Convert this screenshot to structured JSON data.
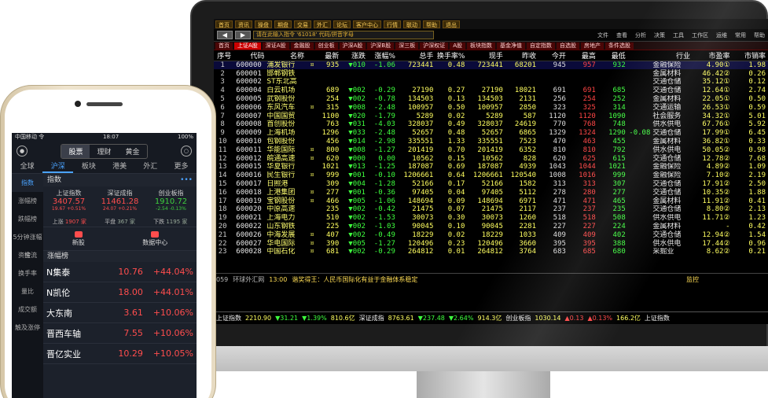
{
  "desktop": {
    "top_menu": [
      "首页",
      "资讯",
      "操盘",
      "期盘",
      "交易",
      "外汇",
      "论坛",
      "客户中心",
      "行情",
      "联动",
      "帮助",
      "退出"
    ],
    "command_placeholder": "请在此输入指令 '61018' 代码/拼音字母",
    "menus": [
      "文件",
      "查看",
      "分析",
      "决策",
      "工具",
      "工作区",
      "运维",
      "常用",
      "帮助"
    ],
    "tabs": [
      "首页",
      "上证A股",
      "深证A股",
      "金融股",
      "创业板",
      "沪深A股",
      "沪深B股",
      "深三板",
      "沪深权证",
      "A股",
      "板块指数",
      "基金净值",
      "自定指数",
      "自选股",
      "房地产",
      "条件选股"
    ],
    "columns": [
      "序号",
      "代码",
      "名称",
      "",
      "最新",
      "涨跌",
      "涨幅%",
      "总手",
      "换手率%",
      "现手",
      "昨收",
      "今开",
      "最高",
      "最低",
      "",
      "行业",
      "市盈率",
      "市销率"
    ],
    "rows": [
      {
        "no": "1",
        "code": "600000",
        "name": "浦发银行",
        "mark": "¤",
        "last": "935",
        "chg": "▼010",
        "pct": "-1.06",
        "vol": "723441",
        "turn": "0.48",
        "cur": "723441",
        "prev": "68201",
        "open": "945",
        "high": "957",
        "low": "932",
        "d1": "",
        "ind": "金融保险",
        "pe": "4.90①",
        "ps": "1.98"
      },
      {
        "no": "2",
        "code": "600001",
        "name": "邯郸钢铁",
        "mark": "",
        "last": "",
        "chg": "",
        "pct": "",
        "vol": "",
        "turn": "",
        "cur": "",
        "prev": "",
        "open": "",
        "high": "",
        "low": "",
        "d1": "",
        "ind": "金属材料",
        "pe": "46.42②",
        "ps": "0.26"
      },
      {
        "no": "3",
        "code": "600002",
        "name": "ST东北高",
        "mark": "",
        "last": "",
        "chg": "",
        "pct": "",
        "vol": "",
        "turn": "",
        "cur": "",
        "prev": "",
        "open": "",
        "high": "",
        "low": "",
        "d1": "",
        "ind": "交通仓储",
        "pe": "35.12①",
        "ps": "0.12"
      },
      {
        "no": "4",
        "code": "600004",
        "name": "白云机场",
        "mark": "",
        "last": "689",
        "chg": "▼002",
        "pct": "-0.29",
        "vol": "27190",
        "turn": "0.27",
        "cur": "27190",
        "prev": "18021",
        "open": "691",
        "high": "691",
        "low": "685",
        "d1": "",
        "ind": "交通仓储",
        "pe": "12.64①",
        "ps": "2.74"
      },
      {
        "no": "5",
        "code": "600005",
        "name": "武钢股份",
        "mark": "",
        "last": "254",
        "chg": "▼002",
        "pct": "-0.78",
        "vol": "134503",
        "turn": "0.13",
        "cur": "134503",
        "prev": "2131",
        "open": "256",
        "high": "254",
        "low": "252",
        "d1": "",
        "ind": "金属材料",
        "pe": "22.05①",
        "ps": "0.50"
      },
      {
        "no": "6",
        "code": "600006",
        "name": "东风汽车",
        "mark": "¤",
        "last": "315",
        "chg": "▼008",
        "pct": "-2.48",
        "vol": "100957",
        "turn": "0.50",
        "cur": "100957",
        "prev": "2850",
        "open": "323",
        "high": "325",
        "low": "314",
        "d1": "",
        "ind": "交通运输",
        "pe": "26.53①",
        "ps": "0.59"
      },
      {
        "no": "7",
        "code": "600007",
        "name": "中国国贸",
        "mark": "",
        "last": "1100",
        "chg": "▼020",
        "pct": "-1.79",
        "vol": "5289",
        "turn": "0.02",
        "cur": "5289",
        "prev": "587",
        "open": "1120",
        "high": "1120",
        "low": "1090",
        "d1": "",
        "ind": "社会服务",
        "pe": "34.32①",
        "ps": "5.01"
      },
      {
        "no": "8",
        "code": "600008",
        "name": "首创股份",
        "mark": "",
        "last": "763",
        "chg": "▼031",
        "pct": "-4.03",
        "vol": "328037",
        "turn": "0.49",
        "cur": "328037",
        "prev": "24619",
        "open": "770",
        "high": "768",
        "low": "748",
        "d1": "",
        "ind": "供水供电",
        "pe": "67.76①",
        "ps": "5.92"
      },
      {
        "no": "9",
        "code": "600009",
        "name": "上海机场",
        "mark": "",
        "last": "1296",
        "chg": "▼033",
        "pct": "-2.48",
        "vol": "52657",
        "turn": "0.48",
        "cur": "52657",
        "prev": "6865",
        "open": "1329",
        "high": "1324",
        "low": "1290",
        "d1": "-0.08",
        "ind": "交通仓储",
        "pe": "17.99①",
        "ps": "6.45"
      },
      {
        "no": "10",
        "code": "600010",
        "name": "包钢股份",
        "mark": "",
        "last": "456",
        "chg": "▼014",
        "pct": "-2.98",
        "vol": "335551",
        "turn": "1.33",
        "cur": "335551",
        "prev": "7523",
        "open": "470",
        "high": "463",
        "low": "455",
        "d1": "",
        "ind": "金属材料",
        "pe": "36.82①",
        "ps": "0.33"
      },
      {
        "no": "11",
        "code": "600011",
        "name": "华能国际",
        "mark": "¤",
        "last": "800",
        "chg": "▼008",
        "pct": "-1.27",
        "vol": "201419",
        "turn": "0.70",
        "cur": "201419",
        "prev": "6352",
        "open": "810",
        "high": "810",
        "low": "792",
        "d1": "",
        "ind": "供水供电",
        "pe": "50.05②",
        "ps": "0.98"
      },
      {
        "no": "12",
        "code": "600012",
        "name": "皖通高速",
        "mark": "¤",
        "last": "620",
        "chg": "▼000",
        "pct": "0.00",
        "vol": "10562",
        "turn": "0.15",
        "cur": "10562",
        "prev": "828",
        "open": "620",
        "high": "625",
        "low": "615",
        "d1": "",
        "ind": "交通仓储",
        "pe": "12.78②",
        "ps": "7.68"
      },
      {
        "no": "13",
        "code": "600015",
        "name": "华夏银行",
        "mark": "",
        "last": "1021",
        "chg": "▼013",
        "pct": "-1.25",
        "vol": "187087",
        "turn": "0.69",
        "cur": "187087",
        "prev": "4939",
        "open": "1043",
        "high": "1044",
        "low": "1021",
        "d1": "",
        "ind": "金融保险",
        "pe": "4.89②",
        "ps": "1.09"
      },
      {
        "no": "14",
        "code": "600016",
        "name": "民生银行",
        "mark": "¤",
        "last": "999",
        "chg": "▼001",
        "pct": "-0.10",
        "vol": "1206661",
        "turn": "0.64",
        "cur": "1206661",
        "prev": "120540",
        "open": "1008",
        "high": "1016",
        "low": "999",
        "d1": "",
        "ind": "金融保险",
        "pe": "7.10②",
        "ps": "2.19"
      },
      {
        "no": "15",
        "code": "600017",
        "name": "日照港",
        "mark": "",
        "last": "309",
        "chg": "▼004",
        "pct": "-1.28",
        "vol": "52166",
        "turn": "0.17",
        "cur": "52166",
        "prev": "1582",
        "open": "313",
        "high": "313",
        "low": "307",
        "d1": "",
        "ind": "交通仓储",
        "pe": "17.91②",
        "ps": "2.50"
      },
      {
        "no": "16",
        "code": "600018",
        "name": "上港集团",
        "mark": "¤",
        "last": "277",
        "chg": "▼001",
        "pct": "-0.36",
        "vol": "97405",
        "turn": "0.04",
        "cur": "97405",
        "prev": "5112",
        "open": "278",
        "high": "280",
        "low": "277",
        "d1": "",
        "ind": "交通仓储",
        "pe": "10.35②",
        "ps": "1.88"
      },
      {
        "no": "17",
        "code": "600019",
        "name": "宝钢股份",
        "mark": "¤",
        "last": "466",
        "chg": "▼005",
        "pct": "-1.06",
        "vol": "148694",
        "turn": "0.09",
        "cur": "148694",
        "prev": "6971",
        "open": "471",
        "high": "471",
        "low": "465",
        "d1": "",
        "ind": "金属材料",
        "pe": "11.91②",
        "ps": "0.41"
      },
      {
        "no": "18",
        "code": "600020",
        "name": "中原高速",
        "mark": "",
        "last": "235",
        "chg": "▼002",
        "pct": "-0.42",
        "vol": "21475",
        "turn": "0.07",
        "cur": "21475",
        "prev": "2117",
        "open": "237",
        "high": "237",
        "low": "235",
        "d1": "",
        "ind": "交通仓储",
        "pe": "8.80②",
        "ps": "2.13"
      },
      {
        "no": "19",
        "code": "600021",
        "name": "上海电力",
        "mark": "",
        "last": "510",
        "chg": "▼002",
        "pct": "-1.53",
        "vol": "30073",
        "turn": "0.30",
        "cur": "30073",
        "prev": "1260",
        "open": "518",
        "high": "518",
        "low": "508",
        "d1": "",
        "ind": "供水供电",
        "pe": "11.71②",
        "ps": "1.23"
      },
      {
        "no": "20",
        "code": "600022",
        "name": "山东钢铁",
        "mark": "",
        "last": "225",
        "chg": "▼002",
        "pct": "-1.03",
        "vol": "90045",
        "turn": "0.10",
        "cur": "90045",
        "prev": "2281",
        "open": "227",
        "high": "227",
        "low": "224",
        "d1": "",
        "ind": "金属材料",
        "pe": "-",
        "ps": "0.42"
      },
      {
        "no": "21",
        "code": "600026",
        "name": "中海发展",
        "mark": "¤",
        "last": "407",
        "chg": "▼002",
        "pct": "-0.49",
        "vol": "18229",
        "turn": "0.02",
        "cur": "18229",
        "prev": "1033",
        "open": "409",
        "high": "409",
        "low": "402",
        "d1": "",
        "ind": "交通仓储",
        "pe": "12.94②",
        "ps": "1.54"
      },
      {
        "no": "22",
        "code": "600027",
        "name": "华电国际",
        "mark": "¤",
        "last": "390",
        "chg": "▼005",
        "pct": "-1.27",
        "vol": "120496",
        "turn": "0.23",
        "cur": "120496",
        "prev": "3660",
        "open": "395",
        "high": "395",
        "low": "388",
        "d1": "",
        "ind": "供水供电",
        "pe": "17.44②",
        "ps": "0.96"
      },
      {
        "no": "23",
        "code": "600028",
        "name": "中国石化",
        "mark": "¤",
        "last": "681",
        "chg": "▼002",
        "pct": "-0.29",
        "vol": "264812",
        "turn": "0.01",
        "cur": "264812",
        "prev": "3764",
        "open": "683",
        "high": "685",
        "low": "680",
        "d1": "",
        "ind": "采掘业",
        "pe": "8.62②",
        "ps": "0.21"
      }
    ],
    "news": {
      "code": "059",
      "source": "环球外汇网",
      "time": "13:00",
      "text": "谐奖得王：人民币国际化有益于金融体系稳定"
    },
    "side_label": "监控",
    "index_bar": [
      {
        "name": "上证指数",
        "value": "2210.90",
        "chg": "▼31.21",
        "pct": "▼1.39%",
        "amt": "810.6亿"
      },
      {
        "name": "深证成指",
        "value": "8763.61",
        "chg": "▼237.48",
        "pct": "▼2.64%",
        "amt": "914.3亿"
      },
      {
        "name": "创业板指",
        "value": "1030.14",
        "chg": "▲0.13",
        "pct": "▲0.13%",
        "amt": "166.2亿"
      },
      {
        "name": "上证指数",
        "value": "",
        "chg": "",
        "pct": "",
        "amt": ""
      }
    ]
  },
  "phone": {
    "status_left": "中国移动 令",
    "status_time": "18:07",
    "status_right": "100%",
    "segments": [
      "股票",
      "理财",
      "黄金"
    ],
    "tabs": [
      "全球",
      "沪深",
      "板块",
      "港美",
      "外汇",
      "更多"
    ],
    "side_menu": [
      "指数",
      "涨幅榜",
      "跌幅榜",
      "5分钟涨幅榜",
      "资金流",
      "换手率",
      "量比",
      "成交额",
      "触及涨停"
    ],
    "index_header": "指数",
    "index_more": "•••",
    "cards": [
      {
        "name": "上证指数",
        "value": "3407.57",
        "chg": "19.67 +0.51%"
      },
      {
        "name": "深证成指",
        "value": "11461.28",
        "chg": "24.07 +0.21%"
      },
      {
        "name": "创业板指",
        "value": "1910.72",
        "chg": "-2.54 -0.13%"
      }
    ],
    "breadth": {
      "up_label": "上涨",
      "up": "1907 家",
      "flat_label": "平盘",
      "flat": "367 家",
      "down_label": "下跌",
      "down": "1195 家"
    },
    "quick": [
      "新股",
      "数据中心"
    ],
    "list_header": "涨幅榜",
    "list": [
      {
        "name": "N集泰",
        "price": "10.76",
        "chg": "+44.04%"
      },
      {
        "name": "N凯伦",
        "price": "18.00",
        "chg": "+44.01%"
      },
      {
        "name": "大东南",
        "price": "3.61",
        "chg": "+10.06%"
      },
      {
        "name": "晋西车轴",
        "price": "7.55",
        "chg": "+10.06%"
      },
      {
        "name": "晋亿实业",
        "price": "10.29",
        "chg": "+10.05%"
      }
    ]
  }
}
